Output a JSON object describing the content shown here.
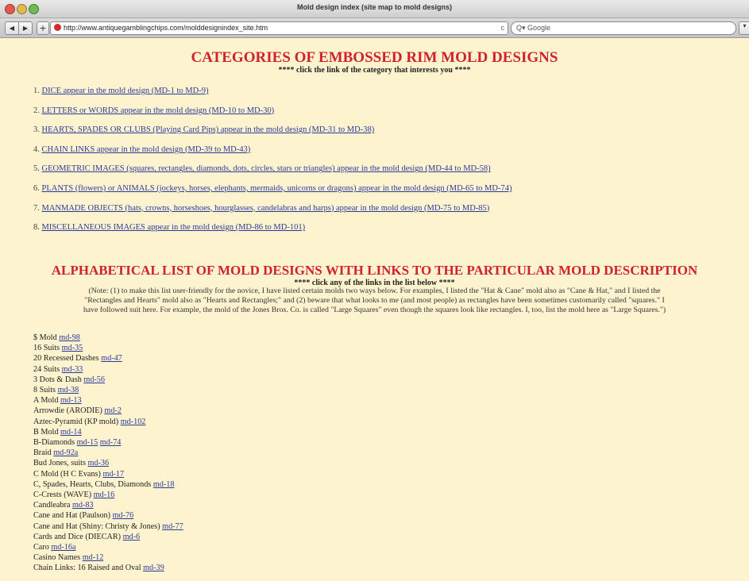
{
  "window": {
    "title": "Mold design index (site map to mold designs)"
  },
  "toolbar": {
    "back": "◀",
    "forward": "▶",
    "add": "+",
    "url": "http://www.antiquegamblingchips.com/molddesignindex_site.htm",
    "search_placeholder": "Q▾ Google"
  },
  "header": {
    "title": "CATEGORIES OF EMBOSSED RIM MOLD DESIGNS",
    "subtitle": "**** click the link of the category that interests you ****"
  },
  "categories": [
    {
      "num": "1.",
      "text": "DICE appear in the mold design  (MD-1 to MD-9)"
    },
    {
      "num": "2.",
      "text": "LETTERS or WORDS appear in the mold design  (MD-10 to MD-30)"
    },
    {
      "num": "3.",
      "text": "HEARTS, SPADES OR CLUBS (Playing Card Pips) appear in the mold design  (MD-31 to MD-38)"
    },
    {
      "num": "4.",
      "text": "CHAIN LINKS appear in the mold design  (MD-39 to MD-43)"
    },
    {
      "num": "5.",
      "text": "GEOMETRIC IMAGES (squares, rectangles, diamonds, dots, circles, stars or triangles) appear in the mold design  (MD-44 to MD-58)"
    },
    {
      "num": "6.",
      "text": "PLANTS (flowers) or ANIMALS (jockeys, horses, elephants, mermaids, unicorns or dragons) appear in the mold design  (MD-65 to MD-74)"
    },
    {
      "num": "7.",
      "text": "MANMADE OBJECTS (hats, crowns, horseshoes, hourglasses, candelabras and harps) appear in the mold design  (MD-75 to MD-85)"
    },
    {
      "num": "8.",
      "text": "MISCELLANEOUS IMAGES appear in the mold design  (MD-86 to MD-101)"
    }
  ],
  "alpha": {
    "title": "ALPHABETICAL LIST OF MOLD DESIGNS WITH LINKS TO THE  PARTICULAR MOLD DESCRIPTION",
    "subtitle": "**** click any of the links in the list below ****",
    "note_line1": "(Note: (1) to make this list user-friendly for the novice, I have listed certain molds two ways below.  For examples, I listed the \"Hat & Cane\" mold also as \"Cane & Hat,\" and I listed the",
    "note_line2": "\"Rectangles and Hearts\" mold also as \"Hearts and Rectangles;\" and (2)  beware that what looks to me (and most people) as rectangles have been sometimes customarily called \"squares.\"  I",
    "note_line3": "have followed suit here.  For example, the mold of the Jones Bros. Co. is called \"Large Squares\" even though the squares look like rectangles.  I, too, list the mold here as \"Large Squares.\")"
  },
  "molds": [
    {
      "name": "$ Mold",
      "links": [
        "md-98"
      ]
    },
    {
      "name": "16 Suits",
      "links": [
        "md-35"
      ]
    },
    {
      "name": "20 Recessed Dashes",
      "links": [
        "md-47"
      ]
    },
    {
      "name": "24 Suits",
      "links": [
        "md-33"
      ]
    },
    {
      "name": "3 Dots & Dash",
      "links": [
        "md-56"
      ]
    },
    {
      "name": "8 Suits",
      "links": [
        "md-38"
      ]
    },
    {
      "name": "A Mold",
      "links": [
        "md-13"
      ]
    },
    {
      "name": "Arrowdie (ARODIE)",
      "links": [
        "md-2"
      ]
    },
    {
      "name": "Aztec-Pyramid (KP mold)",
      "links": [
        "md-102"
      ]
    },
    {
      "name": "B Mold",
      "links": [
        "md-14"
      ]
    },
    {
      "name": "B-Diamonds",
      "links": [
        "md-15",
        "md-74"
      ]
    },
    {
      "name": "Braid",
      "links": [
        "md-92a"
      ]
    },
    {
      "name": "Bud Jones, suits",
      "links": [
        "md-36"
      ]
    },
    {
      "name": "C Mold (H C Evans)",
      "links": [
        "md-17"
      ]
    },
    {
      "name": "C, Spades, Hearts, Clubs, Diamonds",
      "links": [
        "md-18"
      ]
    },
    {
      "name": "C-Crests (WAVE)",
      "links": [
        "md-16"
      ]
    },
    {
      "name": "Candleabra",
      "links": [
        "md-83"
      ]
    },
    {
      "name": "Cane and Hat (Paulson)",
      "links": [
        "md-76"
      ]
    },
    {
      "name": "Cane and Hat (Shiny:  Christy & Jones)",
      "links": [
        "md-77"
      ]
    },
    {
      "name": "Cards and Dice (DIECAR)",
      "links": [
        "md-6"
      ]
    },
    {
      "name": "Caro",
      "links": [
        "md-16a"
      ]
    },
    {
      "name": "Casino Names",
      "links": [
        "md-12"
      ]
    },
    {
      "name": "Chain Links:  16 Raised and Oval",
      "links": [
        "md-39"
      ]
    }
  ]
}
